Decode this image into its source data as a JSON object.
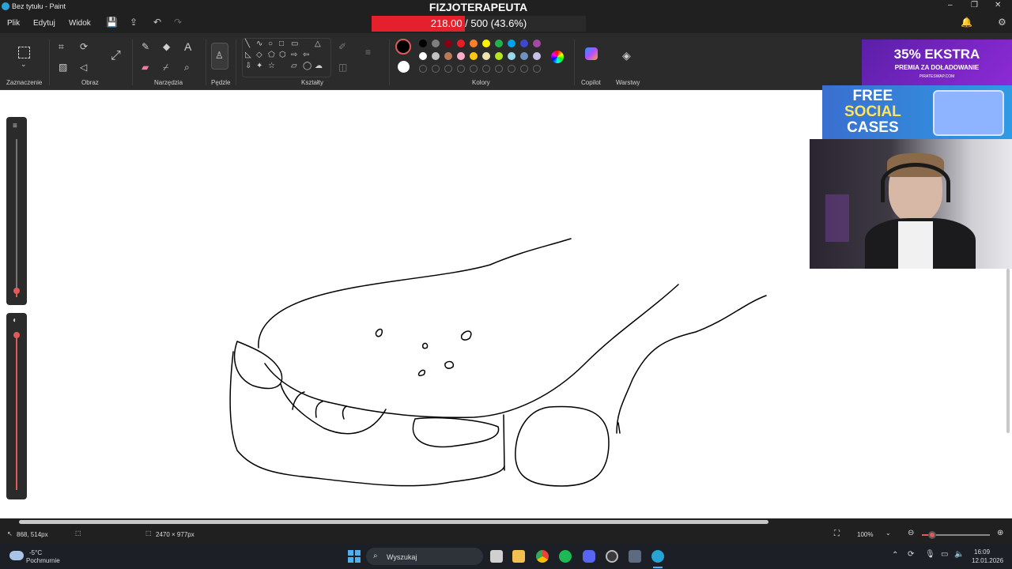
{
  "window": {
    "title": "Bez tytułu - Paint",
    "controls": [
      "–",
      "❐",
      "✕"
    ]
  },
  "menu": {
    "items": [
      "Plik",
      "Edytuj",
      "Widok"
    ]
  },
  "stream": {
    "goal_title": "FIZJOTERAPEUTA",
    "goal_progress": "218.00 / 500 (43.6%)",
    "goal_fraction": 0.436,
    "goal_color": "#e3202c"
  },
  "toolbar": {
    "groups": {
      "selection": "Zaznaczenie",
      "image": "Obraz",
      "tools": "Narzędzia",
      "brushes": "Pędzle",
      "shapes": "Kształty",
      "colors": "Kolory",
      "copilot": "Copilot",
      "layers": "Warstwy"
    },
    "shape_glyphs": [
      "╲",
      "∿",
      "○",
      "□",
      "▭",
      "△",
      "◺",
      "◇",
      "⬠",
      "⬡",
      "⇨",
      "⇦",
      "⇩",
      "✦",
      "☆",
      "▱",
      "◯",
      "☁"
    ],
    "palette_row1": [
      "#000000",
      "#7f7f7f",
      "#880015",
      "#ed1c24",
      "#ff7f27",
      "#fff200",
      "#22b14c",
      "#00a2e8",
      "#3f48cc",
      "#a349a4"
    ],
    "palette_row2": [
      "#ffffff",
      "#c3c3c3",
      "#b97a57",
      "#ffaec9",
      "#ffc90e",
      "#efe4b0",
      "#b5e61d",
      "#99d9ea",
      "#7092be",
      "#c8bfe7"
    ],
    "primary_color": "#000000",
    "secondary_color": "#ffffff"
  },
  "ads": {
    "ad1_main": "35% EKSTRA",
    "ad1_sub": "PREMIA ZA DOŁADOWANIE",
    "ad1_site": "PIRATESWAP.COM",
    "ad2_line1": "FREE",
    "ad2_line2": "SOCIAL",
    "ad2_line3": "CASES"
  },
  "status": {
    "cursor_pos": "868, 514px",
    "canvas_size": "2470 × 977px",
    "zoom": "100%"
  },
  "taskbar": {
    "weather_temp": "-5°C",
    "weather_desc": "Pochmurnie",
    "search_placeholder": "Wyszukaj",
    "time": "16:09",
    "date": "12.01.2026"
  }
}
